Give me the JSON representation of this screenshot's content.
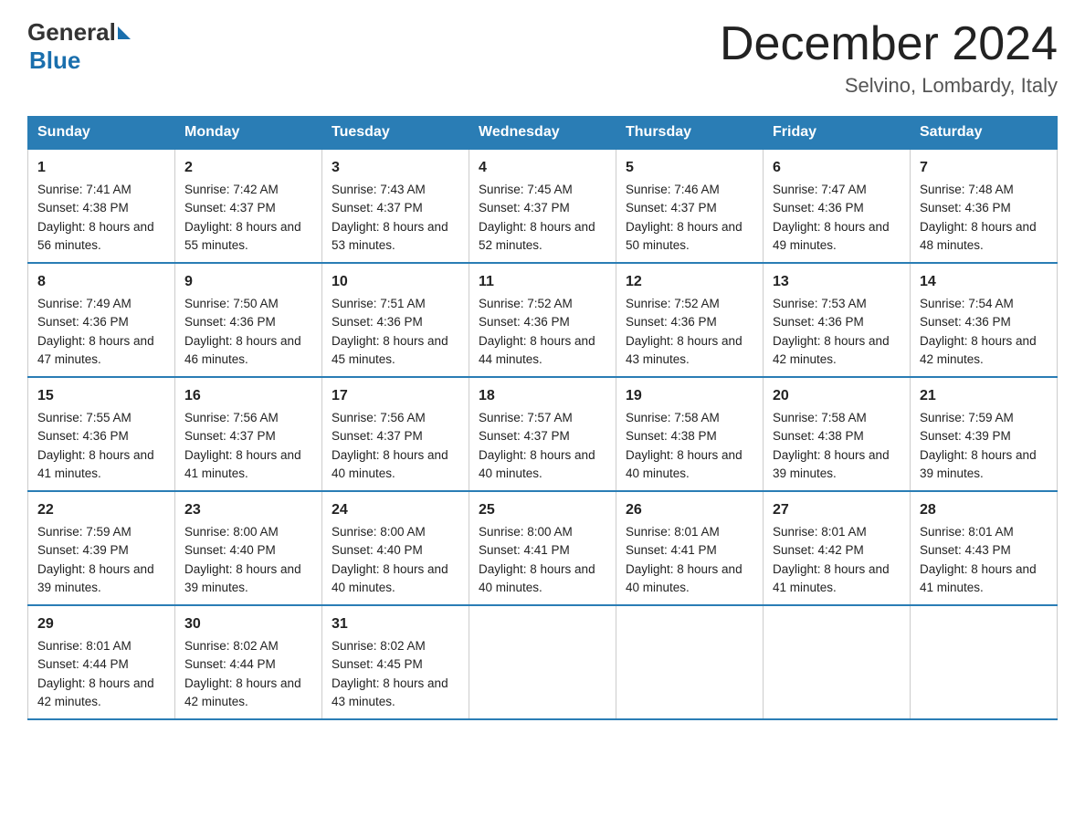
{
  "header": {
    "logo_general": "General",
    "logo_blue": "Blue",
    "month_title": "December 2024",
    "location": "Selvino, Lombardy, Italy"
  },
  "days_of_week": [
    "Sunday",
    "Monday",
    "Tuesday",
    "Wednesday",
    "Thursday",
    "Friday",
    "Saturday"
  ],
  "weeks": [
    [
      {
        "day": "1",
        "sunrise": "7:41 AM",
        "sunset": "4:38 PM",
        "daylight": "8 hours and 56 minutes."
      },
      {
        "day": "2",
        "sunrise": "7:42 AM",
        "sunset": "4:37 PM",
        "daylight": "8 hours and 55 minutes."
      },
      {
        "day": "3",
        "sunrise": "7:43 AM",
        "sunset": "4:37 PM",
        "daylight": "8 hours and 53 minutes."
      },
      {
        "day": "4",
        "sunrise": "7:45 AM",
        "sunset": "4:37 PM",
        "daylight": "8 hours and 52 minutes."
      },
      {
        "day": "5",
        "sunrise": "7:46 AM",
        "sunset": "4:37 PM",
        "daylight": "8 hours and 50 minutes."
      },
      {
        "day": "6",
        "sunrise": "7:47 AM",
        "sunset": "4:36 PM",
        "daylight": "8 hours and 49 minutes."
      },
      {
        "day": "7",
        "sunrise": "7:48 AM",
        "sunset": "4:36 PM",
        "daylight": "8 hours and 48 minutes."
      }
    ],
    [
      {
        "day": "8",
        "sunrise": "7:49 AM",
        "sunset": "4:36 PM",
        "daylight": "8 hours and 47 minutes."
      },
      {
        "day": "9",
        "sunrise": "7:50 AM",
        "sunset": "4:36 PM",
        "daylight": "8 hours and 46 minutes."
      },
      {
        "day": "10",
        "sunrise": "7:51 AM",
        "sunset": "4:36 PM",
        "daylight": "8 hours and 45 minutes."
      },
      {
        "day": "11",
        "sunrise": "7:52 AM",
        "sunset": "4:36 PM",
        "daylight": "8 hours and 44 minutes."
      },
      {
        "day": "12",
        "sunrise": "7:52 AM",
        "sunset": "4:36 PM",
        "daylight": "8 hours and 43 minutes."
      },
      {
        "day": "13",
        "sunrise": "7:53 AM",
        "sunset": "4:36 PM",
        "daylight": "8 hours and 42 minutes."
      },
      {
        "day": "14",
        "sunrise": "7:54 AM",
        "sunset": "4:36 PM",
        "daylight": "8 hours and 42 minutes."
      }
    ],
    [
      {
        "day": "15",
        "sunrise": "7:55 AM",
        "sunset": "4:36 PM",
        "daylight": "8 hours and 41 minutes."
      },
      {
        "day": "16",
        "sunrise": "7:56 AM",
        "sunset": "4:37 PM",
        "daylight": "8 hours and 41 minutes."
      },
      {
        "day": "17",
        "sunrise": "7:56 AM",
        "sunset": "4:37 PM",
        "daylight": "8 hours and 40 minutes."
      },
      {
        "day": "18",
        "sunrise": "7:57 AM",
        "sunset": "4:37 PM",
        "daylight": "8 hours and 40 minutes."
      },
      {
        "day": "19",
        "sunrise": "7:58 AM",
        "sunset": "4:38 PM",
        "daylight": "8 hours and 40 minutes."
      },
      {
        "day": "20",
        "sunrise": "7:58 AM",
        "sunset": "4:38 PM",
        "daylight": "8 hours and 39 minutes."
      },
      {
        "day": "21",
        "sunrise": "7:59 AM",
        "sunset": "4:39 PM",
        "daylight": "8 hours and 39 minutes."
      }
    ],
    [
      {
        "day": "22",
        "sunrise": "7:59 AM",
        "sunset": "4:39 PM",
        "daylight": "8 hours and 39 minutes."
      },
      {
        "day": "23",
        "sunrise": "8:00 AM",
        "sunset": "4:40 PM",
        "daylight": "8 hours and 39 minutes."
      },
      {
        "day": "24",
        "sunrise": "8:00 AM",
        "sunset": "4:40 PM",
        "daylight": "8 hours and 40 minutes."
      },
      {
        "day": "25",
        "sunrise": "8:00 AM",
        "sunset": "4:41 PM",
        "daylight": "8 hours and 40 minutes."
      },
      {
        "day": "26",
        "sunrise": "8:01 AM",
        "sunset": "4:41 PM",
        "daylight": "8 hours and 40 minutes."
      },
      {
        "day": "27",
        "sunrise": "8:01 AM",
        "sunset": "4:42 PM",
        "daylight": "8 hours and 41 minutes."
      },
      {
        "day": "28",
        "sunrise": "8:01 AM",
        "sunset": "4:43 PM",
        "daylight": "8 hours and 41 minutes."
      }
    ],
    [
      {
        "day": "29",
        "sunrise": "8:01 AM",
        "sunset": "4:44 PM",
        "daylight": "8 hours and 42 minutes."
      },
      {
        "day": "30",
        "sunrise": "8:02 AM",
        "sunset": "4:44 PM",
        "daylight": "8 hours and 42 minutes."
      },
      {
        "day": "31",
        "sunrise": "8:02 AM",
        "sunset": "4:45 PM",
        "daylight": "8 hours and 43 minutes."
      },
      null,
      null,
      null,
      null
    ]
  ],
  "labels": {
    "sunrise": "Sunrise:",
    "sunset": "Sunset:",
    "daylight": "Daylight:"
  }
}
